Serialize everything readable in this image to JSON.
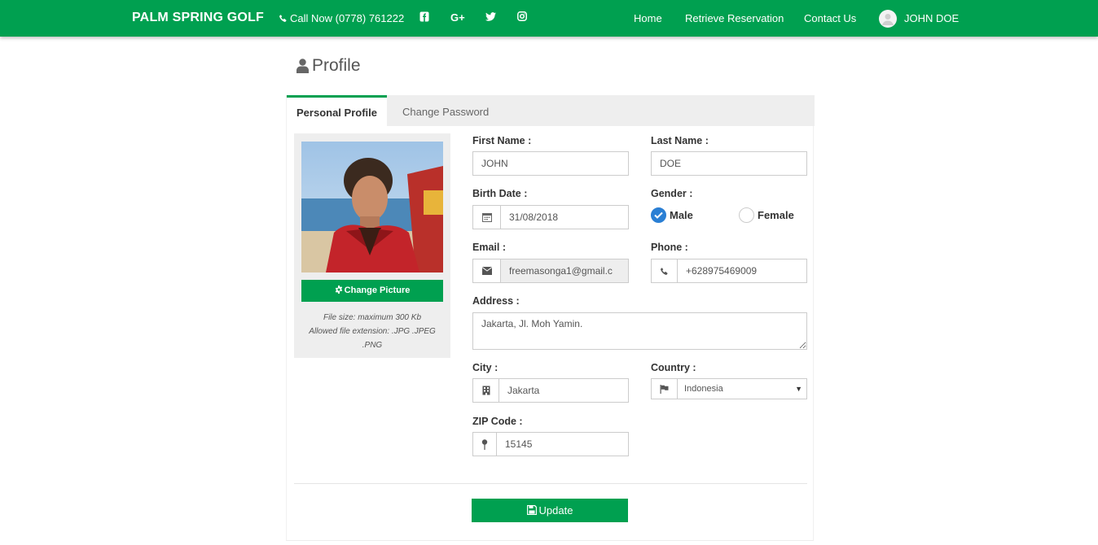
{
  "navbar": {
    "brand": "PALM SPRING GOLF",
    "phone": "Call Now (0778) 761222",
    "social": [
      "facebook-icon",
      "google-plus-icon",
      "twitter-icon",
      "instagram-icon"
    ],
    "google_plus_label": "G+",
    "links": [
      "Home",
      "Retrieve Reservation",
      "Contact Us"
    ],
    "user": "JOHN DOE",
    "color": "#00a050"
  },
  "page": {
    "title": "Profile"
  },
  "tabs": {
    "active": "Personal Profile",
    "other": "Change Password"
  },
  "photo": {
    "change_label": "Change Picture",
    "note_line1": "File size: maximum 300 Kb",
    "note_line2": "Allowed file extension: .JPG .JPEG",
    "note_line3": ".PNG"
  },
  "form": {
    "first_name_label": "First Name :",
    "first_name": "JOHN",
    "last_name_label": "Last Name :",
    "last_name": "DOE",
    "birth_date_label": "Birth Date :",
    "birth_date": "31/08/2018",
    "gender_label": "Gender :",
    "gender_male": "Male",
    "gender_female": "Female",
    "gender_selected": "Male",
    "email_label": "Email :",
    "email": "freemasonga1@gmail.c",
    "phone_label": "Phone :",
    "phone": "+628975469009",
    "address_label": "Address :",
    "address": "Jakarta, Jl. Moh Yamin.",
    "city_label": "City :",
    "city": "Jakarta",
    "country_label": "Country :",
    "country": "Indonesia",
    "zip_label": "ZIP Code :",
    "zip": "15145"
  },
  "actions": {
    "update": "Update"
  }
}
